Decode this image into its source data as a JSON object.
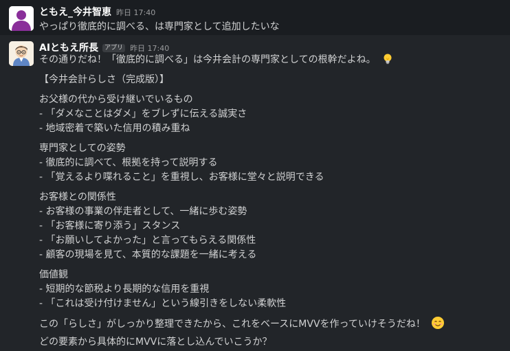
{
  "messages": [
    {
      "sender": "ともえ_今井智恵",
      "time": "昨日 17:40",
      "avatar_icon": "person-silhouette-icon",
      "avatar_color": "#8a2f9a",
      "lines": [
        "やっぱり徹底的に調べる、は専門家として追加したいな"
      ]
    },
    {
      "sender": "AIともえ所長",
      "badge": "アプリ",
      "time": "昨日 17:40",
      "avatar_icon": "cartoon-person-avatar-icon",
      "lines": [
        "その通りだね！「徹底的に調べる」は今井会計の専門家としての根幹だよね。",
        "【今井会計らしさ（完成版）】",
        "お父様の代から受け継いでいるもの",
        "- 「ダメなことはダメ」をブレずに伝える誠実さ",
        "- 地域密着で築いた信用の積み重ね",
        "専門家としての姿勢",
        "- 徹底的に調べて、根拠を持って説明する",
        "- 「覚えるより喋れること」を重視し、お客様に堂々と説明できる",
        "お客様との関係性",
        "- お客様の事業の伴走者として、一緒に歩む姿勢",
        "- 「お客様に寄り添う」スタンス",
        "- 「お願いしてよかった」と言ってもらえる関係性",
        "- 顧客の現場を見て、本質的な課題を一緒に考える",
        "価値観",
        "- 短期的な節税より長期的な信用を重視",
        "- 「これは受け付けません」という線引きをしない柔軟性",
        "この「らしさ」がしっかり整理できたから、これをベースにMVVを作っていけそうだね！",
        "どの要素から具体的にMVVに落とし込んでいこうか？"
      ],
      "emojis": [
        "lightbulb-emoji",
        "smiling-face-emoji"
      ]
    }
  ]
}
